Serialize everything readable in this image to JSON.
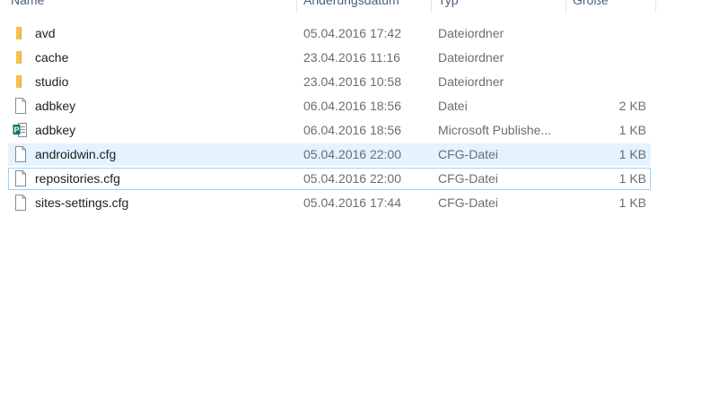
{
  "columns": {
    "name": "Name",
    "date": "Änderungsdatum",
    "type": "Typ",
    "size": "Größe"
  },
  "files": [
    {
      "name": "avd",
      "date": "05.04.2016 17:42",
      "type": "Dateiordner",
      "size": "",
      "icon": "folder-icon"
    },
    {
      "name": "cache",
      "date": "23.04.2016 11:16",
      "type": "Dateiordner",
      "size": "",
      "icon": "folder-icon"
    },
    {
      "name": "studio",
      "date": "23.04.2016 10:58",
      "type": "Dateiordner",
      "size": "",
      "icon": "folder-icon"
    },
    {
      "name": "adbkey",
      "date": "06.04.2016 18:56",
      "type": "Datei",
      "size": "2 KB",
      "icon": "file-icon"
    },
    {
      "name": "adbkey",
      "date": "06.04.2016 18:56",
      "type": "Microsoft Publishe...",
      "size": "1 KB",
      "icon": "publisher-file-icon"
    },
    {
      "name": "androidwin.cfg",
      "date": "05.04.2016 22:00",
      "type": "CFG-Datei",
      "size": "1 KB",
      "icon": "file-icon"
    },
    {
      "name": "repositories.cfg",
      "date": "05.04.2016 22:00",
      "type": "CFG-Datei",
      "size": "1 KB",
      "icon": "file-icon"
    },
    {
      "name": "sites-settings.cfg",
      "date": "05.04.2016 17:44",
      "type": "CFG-Datei",
      "size": "1 KB",
      "icon": "file-icon"
    }
  ],
  "colors": {
    "selected_row": "#e5f3ff",
    "focus_border": "#99d1ff",
    "folder": "#f5c14e",
    "publisher_green": "#077568"
  }
}
